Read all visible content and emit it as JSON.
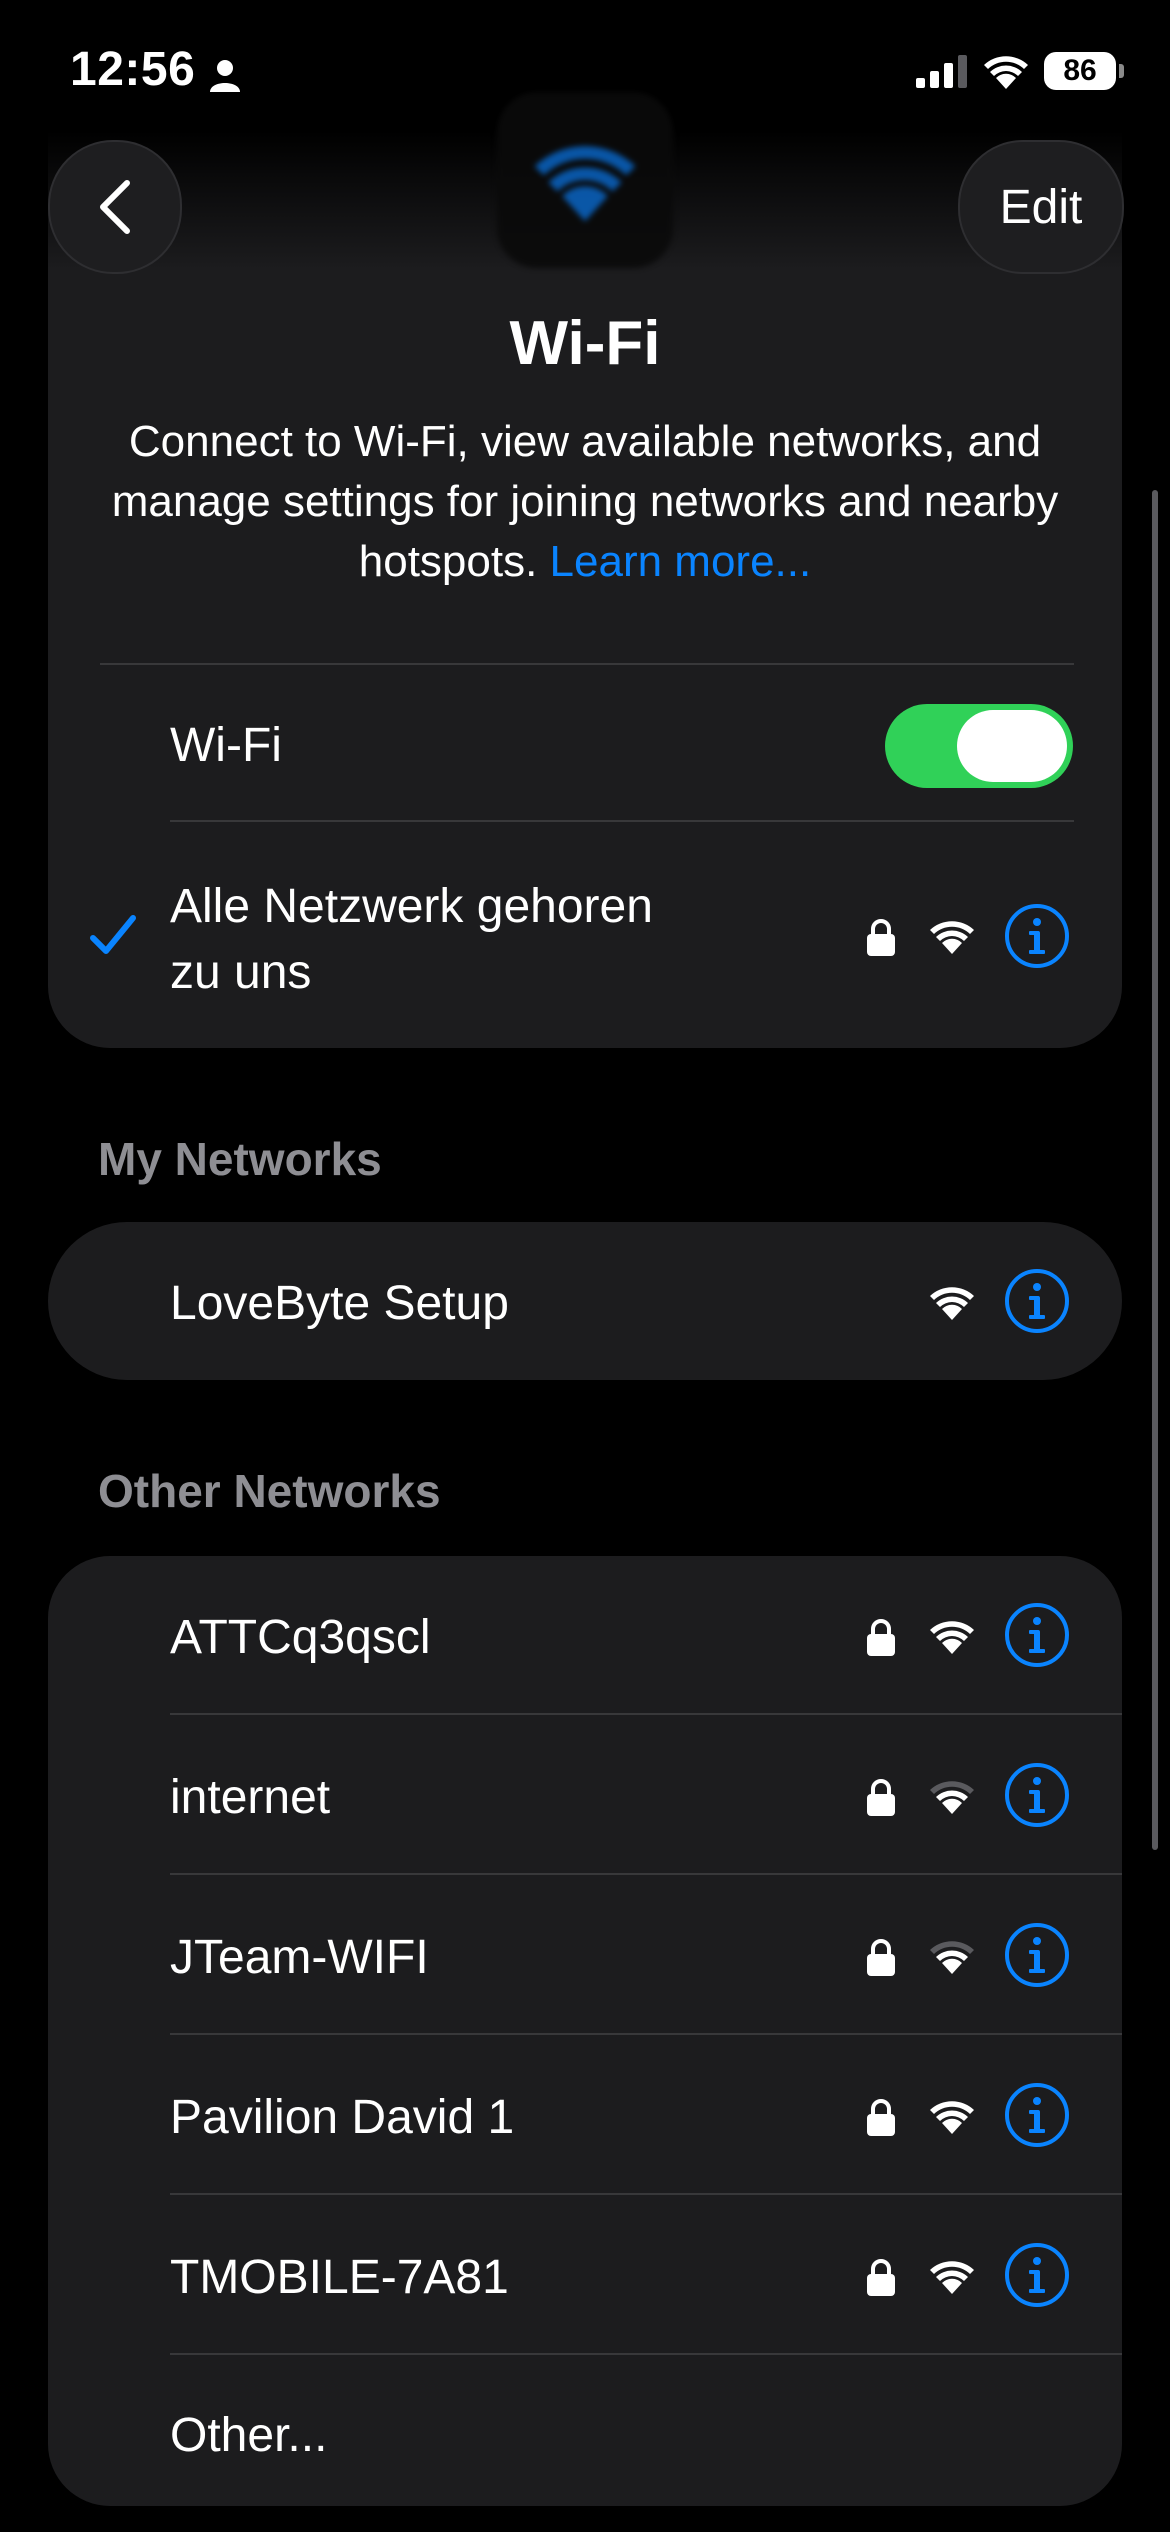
{
  "status": {
    "time": "12:56",
    "battery": "86"
  },
  "nav": {
    "edit_label": "Edit"
  },
  "header": {
    "title": "Wi-Fi",
    "description": "Connect to Wi-Fi, view available networks, and manage settings for joining networks and nearby hotspots.",
    "link": "Learn more..."
  },
  "wifi_toggle": {
    "label": "Wi-Fi",
    "state": "on"
  },
  "connected": {
    "name_line1": "Alle Netzwerk gehoren",
    "name_line2": "zu uns"
  },
  "my_networks": {
    "header": "My Networks",
    "items": [
      {
        "name": "LoveByte Setup"
      }
    ]
  },
  "other_networks": {
    "header": "Other Networks",
    "items": [
      {
        "name": "ATTCq3qscl"
      },
      {
        "name": "internet"
      },
      {
        "name": "JTeam-WIFI"
      },
      {
        "name": "Pavilion David 1"
      },
      {
        "name": "TMOBILE-7A81"
      }
    ],
    "other_label": "Other..."
  },
  "colors": {
    "accent": "#0a84ff",
    "toggle_on": "#30d158",
    "card": "#1c1c1e"
  }
}
